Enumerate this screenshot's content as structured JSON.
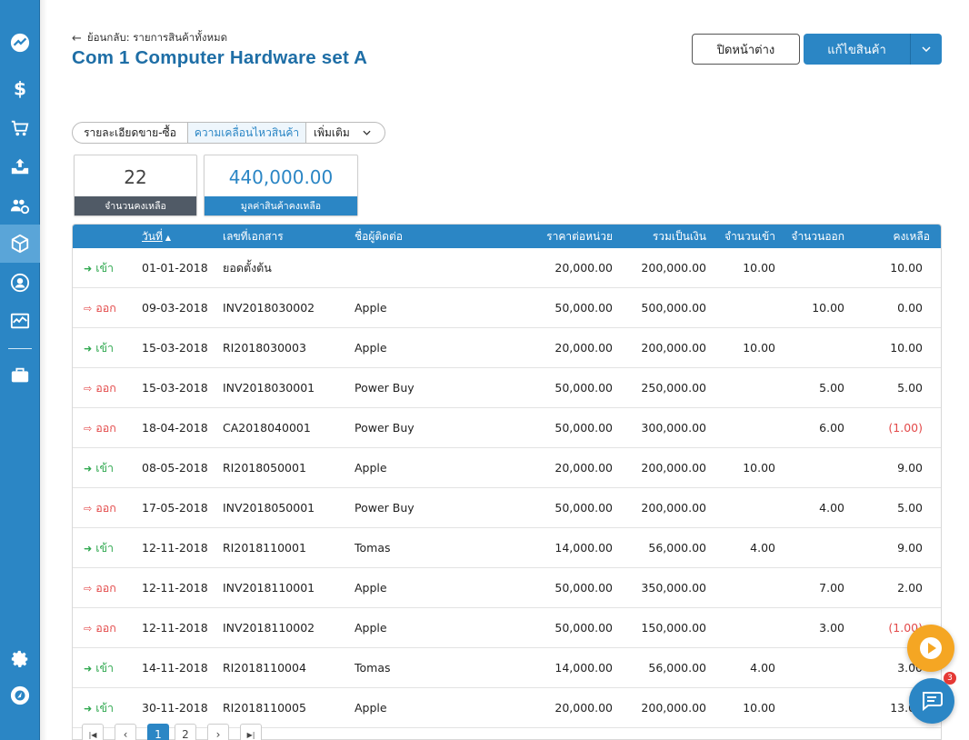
{
  "header": {
    "back_label": "ย้อนกลับ: รายการสินค้าทั้งหมด",
    "title": "Com 1 Computer Hardware set A",
    "close_label": "ปิดหน้าต่าง",
    "edit_label": "แก้ไขสินค้า"
  },
  "tabs": [
    {
      "label": "รายละเอียดขาย-ซื้อ"
    },
    {
      "label": "ความเคลื่อนไหวสินค้า"
    },
    {
      "label": "เพิ่มเติม"
    }
  ],
  "stats": {
    "remaining_qty": {
      "value": "22",
      "label": "จำนวนคงเหลือ"
    },
    "remaining_value": {
      "value": "440,000.00",
      "label": "มูลค่าสินค้าคงเหลือ"
    }
  },
  "table": {
    "columns": {
      "date": "วันที่",
      "doc": "เลขที่เอกสาร",
      "contact": "ชื่อผู้ติดต่อ",
      "unit_price": "ราคาต่อหน่วย",
      "total": "รวมเป็นเงิน",
      "qty_in": "จำนวนเข้า",
      "qty_out": "จำนวนออก",
      "balance": "คงเหลือ"
    },
    "rows": [
      {
        "dir": "เข้า",
        "date": "01-01-2018",
        "doc": "ยอดตั้งต้น",
        "contact": "",
        "unit_price": "20,000.00",
        "total": "200,000.00",
        "qty_in": "10.00",
        "qty_out": "",
        "balance": "10.00"
      },
      {
        "dir": "ออก",
        "date": "09-03-2018",
        "doc": "INV2018030002",
        "contact": "Apple",
        "unit_price": "50,000.00",
        "total": "500,000.00",
        "qty_in": "",
        "qty_out": "10.00",
        "balance": "0.00"
      },
      {
        "dir": "เข้า",
        "date": "15-03-2018",
        "doc": "RI2018030003",
        "contact": "Apple",
        "unit_price": "20,000.00",
        "total": "200,000.00",
        "qty_in": "10.00",
        "qty_out": "",
        "balance": "10.00"
      },
      {
        "dir": "ออก",
        "date": "15-03-2018",
        "doc": "INV2018030001",
        "contact": "Power Buy",
        "unit_price": "50,000.00",
        "total": "250,000.00",
        "qty_in": "",
        "qty_out": "5.00",
        "balance": "5.00"
      },
      {
        "dir": "ออก",
        "date": "18-04-2018",
        "doc": "CA2018040001",
        "contact": "Power Buy",
        "unit_price": "50,000.00",
        "total": "300,000.00",
        "qty_in": "",
        "qty_out": "6.00",
        "balance": "(1.00)"
      },
      {
        "dir": "เข้า",
        "date": "08-05-2018",
        "doc": "RI2018050001",
        "contact": "Apple",
        "unit_price": "20,000.00",
        "total": "200,000.00",
        "qty_in": "10.00",
        "qty_out": "",
        "balance": "9.00"
      },
      {
        "dir": "ออก",
        "date": "17-05-2018",
        "doc": "INV2018050001",
        "contact": "Power Buy",
        "unit_price": "50,000.00",
        "total": "200,000.00",
        "qty_in": "",
        "qty_out": "4.00",
        "balance": "5.00"
      },
      {
        "dir": "เข้า",
        "date": "12-11-2018",
        "doc": "RI2018110001",
        "contact": "Tomas",
        "unit_price": "14,000.00",
        "total": "56,000.00",
        "qty_in": "4.00",
        "qty_out": "",
        "balance": "9.00"
      },
      {
        "dir": "ออก",
        "date": "12-11-2018",
        "doc": "INV2018110001",
        "contact": "Apple",
        "unit_price": "50,000.00",
        "total": "350,000.00",
        "qty_in": "",
        "qty_out": "7.00",
        "balance": "2.00"
      },
      {
        "dir": "ออก",
        "date": "12-11-2018",
        "doc": "INV2018110002",
        "contact": "Apple",
        "unit_price": "50,000.00",
        "total": "150,000.00",
        "qty_in": "",
        "qty_out": "3.00",
        "balance": "(1.00)"
      },
      {
        "dir": "เข้า",
        "date": "14-11-2018",
        "doc": "RI2018110004",
        "contact": "Tomas",
        "unit_price": "14,000.00",
        "total": "56,000.00",
        "qty_in": "4.00",
        "qty_out": "",
        "balance": "3.00"
      },
      {
        "dir": "เข้า",
        "date": "30-11-2018",
        "doc": "RI2018110005",
        "contact": "Apple",
        "unit_price": "20,000.00",
        "total": "200,000.00",
        "qty_in": "10.00",
        "qty_out": "",
        "balance": "13.00"
      }
    ]
  },
  "pagination": {
    "first": "⏮",
    "prev": "‹",
    "pages": [
      "1",
      "2"
    ],
    "current": "1",
    "next": "›",
    "last": "⏭"
  },
  "chat_badge": "3",
  "colors": {
    "primary": "#2b86c5",
    "in": "#2fa84f",
    "out": "#e34a4a",
    "fab_play": "#f5a623"
  },
  "sidebar_icons": [
    "chart-icon",
    "dollar-icon",
    "cart-icon",
    "inbox-upload-icon",
    "contacts-icon",
    "box-icon",
    "user-circle-icon",
    "activity-icon",
    "briefcase-icon",
    "gear-icon",
    "logo-icon"
  ]
}
